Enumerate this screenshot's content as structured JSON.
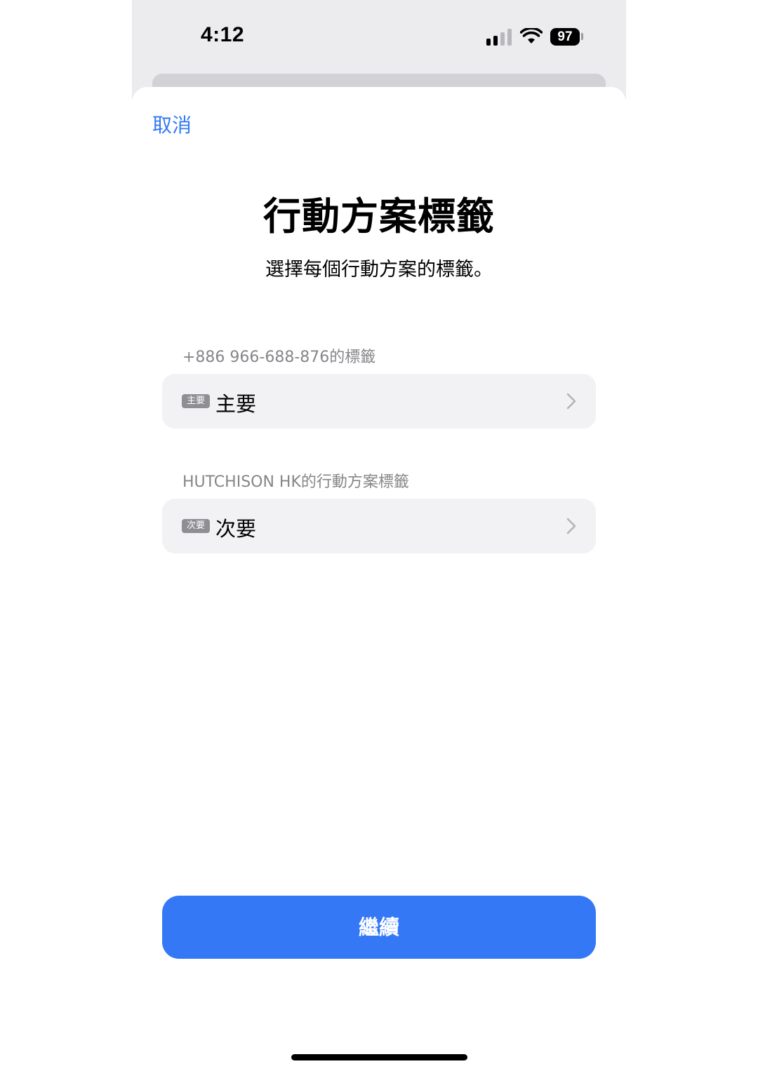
{
  "status_bar": {
    "time": "4:12",
    "battery": "97"
  },
  "sheet": {
    "cancel_label": "取消",
    "title": "行動方案標籤",
    "subtitle": "選擇每個行動方案的標籤。",
    "sections": [
      {
        "label": "+886 966-688-876的標籤",
        "badge": "主要",
        "value": "主要"
      },
      {
        "label": "HUTCHISON HK的行動方案標籤",
        "badge": "次要",
        "value": "次要"
      }
    ],
    "continue_label": "繼續"
  },
  "colors": {
    "accent": "#3478f6",
    "row_background": "#f2f2f4",
    "secondary_text": "#86868b"
  },
  "icons": {
    "signal": "cellular-signal-icon",
    "wifi": "wifi-icon",
    "battery": "battery-icon",
    "chevron": "chevron-right-icon"
  }
}
